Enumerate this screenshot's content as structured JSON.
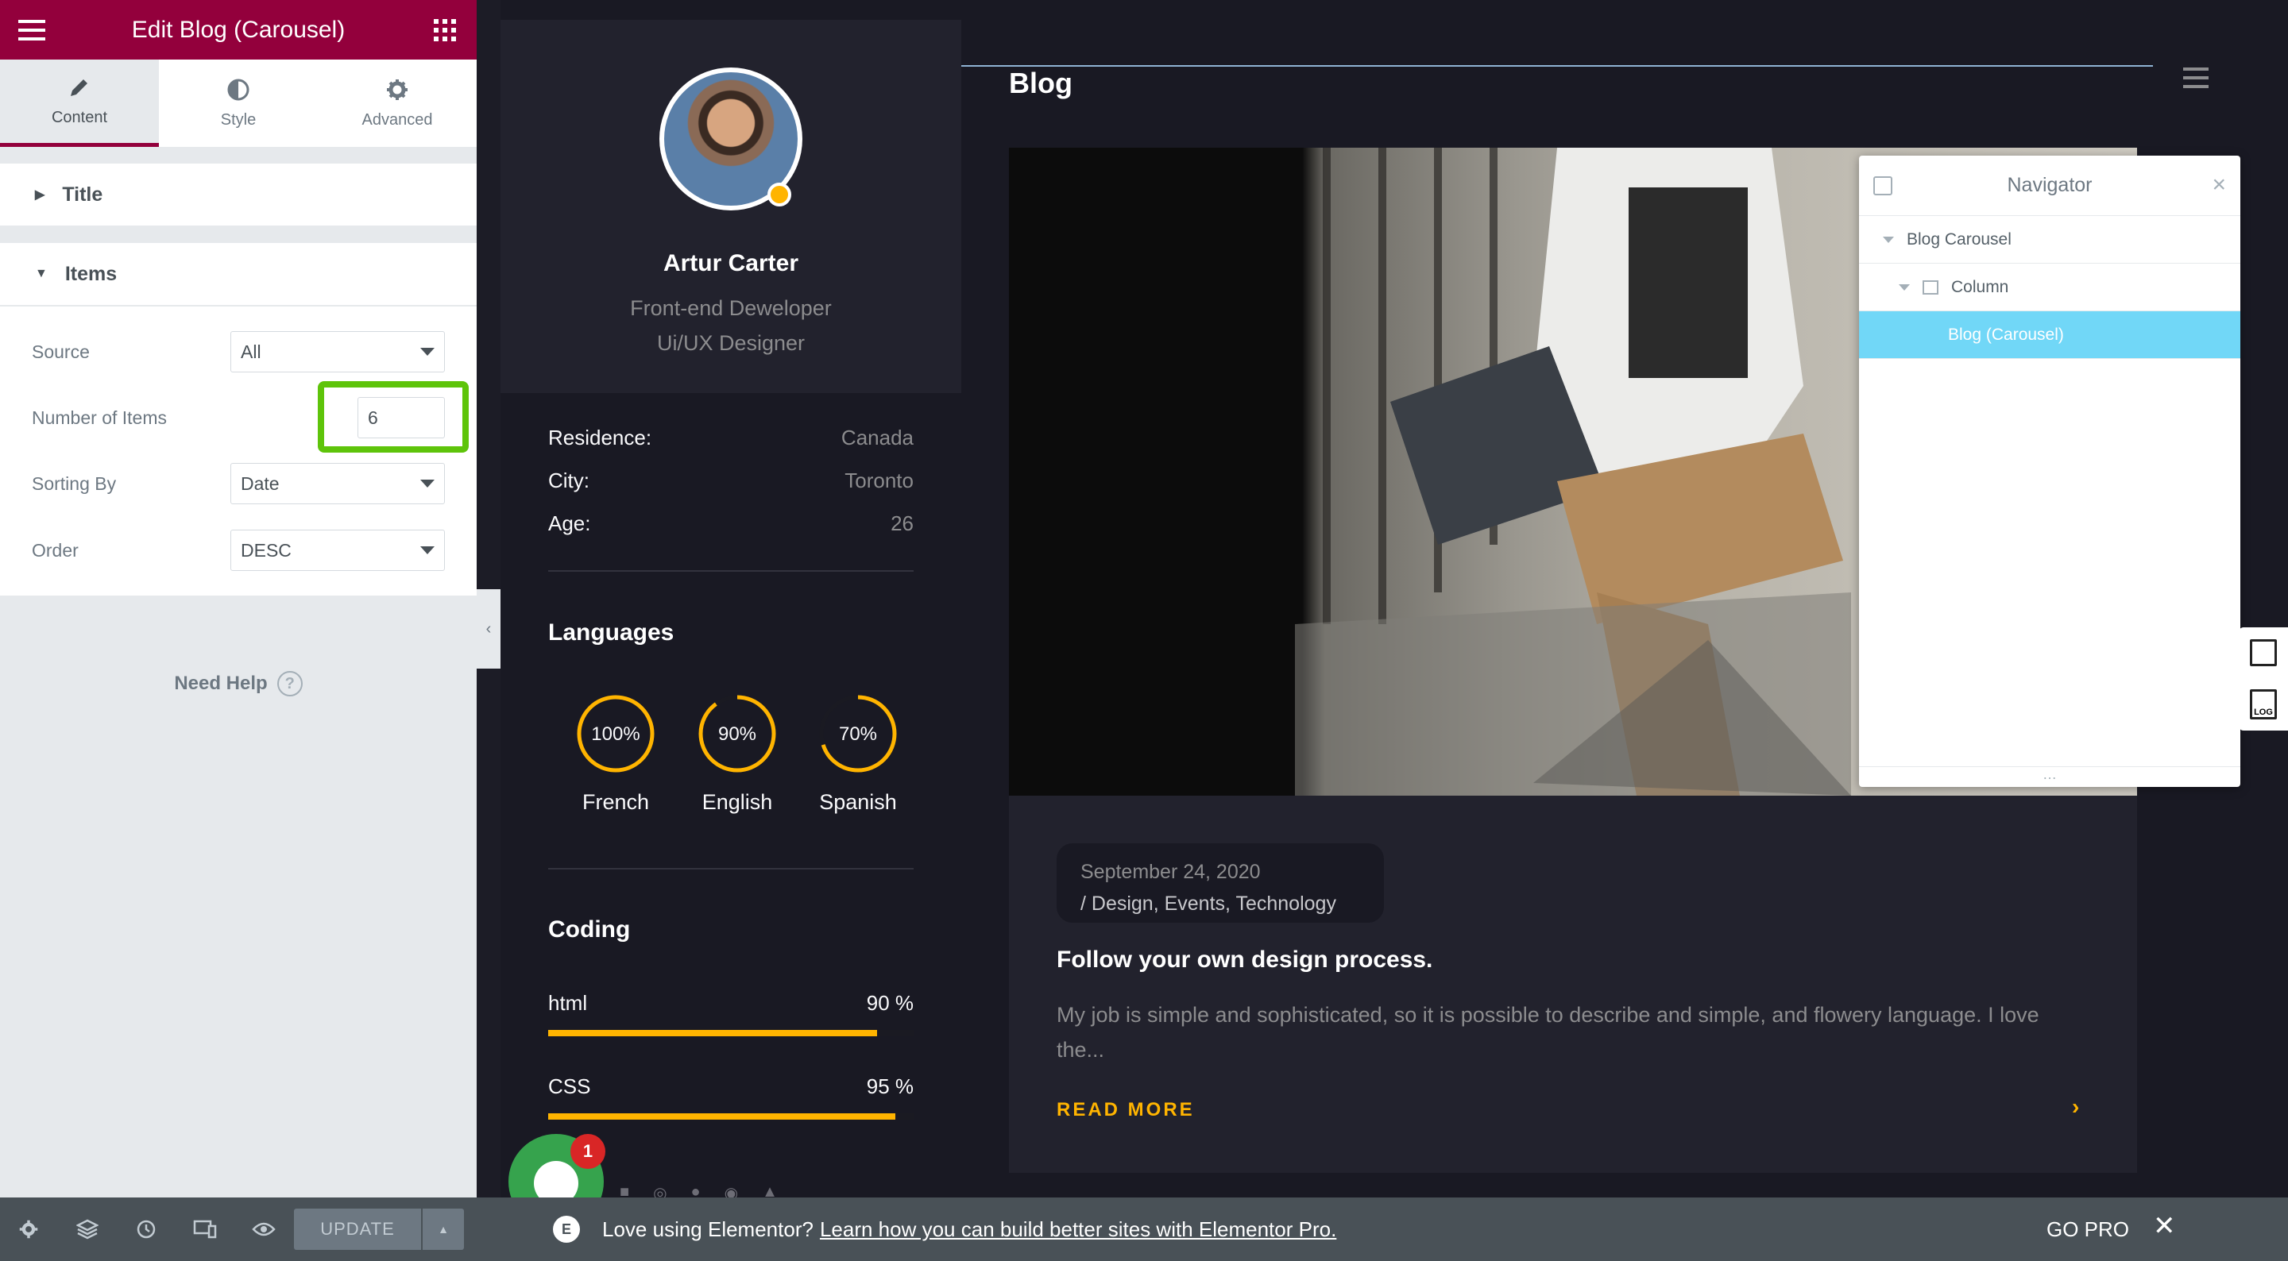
{
  "panel": {
    "header_title": "Edit Blog (Carousel)",
    "tabs": [
      {
        "label": "Content",
        "icon": "pencil-icon"
      },
      {
        "label": "Style",
        "icon": "contrast-icon"
      },
      {
        "label": "Advanced",
        "icon": "gear-icon"
      }
    ],
    "sections": {
      "title": "Title",
      "items": "Items"
    },
    "controls": {
      "source_label": "Source",
      "source_value": "All",
      "number_label": "Number of Items",
      "number_value": "6",
      "sorting_label": "Sorting By",
      "sorting_value": "Date",
      "order_label": "Order",
      "order_value": "DESC"
    },
    "need_help": "Need Help",
    "footer": {
      "update_label": "UPDATE"
    }
  },
  "profile": {
    "name": "Artur Carter",
    "role_line1": "Front-end Deweloper",
    "role_line2": "Ui/UX Designer",
    "info": [
      {
        "k": "Residence:",
        "v": "Canada"
      },
      {
        "k": "City:",
        "v": "Toronto"
      },
      {
        "k": "Age:",
        "v": "26"
      }
    ],
    "languages_title": "Languages",
    "languages": [
      {
        "name": "French",
        "pct_label": "100%",
        "pct": 100
      },
      {
        "name": "English",
        "pct_label": "90%",
        "pct": 90
      },
      {
        "name": "Spanish",
        "pct_label": "70%",
        "pct": 70
      }
    ],
    "coding_title": "Coding",
    "skills": [
      {
        "name": "html",
        "pct_label": "90 %",
        "pct": 90
      },
      {
        "name": "CSS",
        "pct_label": "95 %",
        "pct": 95
      }
    ]
  },
  "blog": {
    "title": "Blog",
    "date": "September 24, 2020",
    "categories": "/ Design, Events, Technology",
    "post_title": "Follow your own design process.",
    "excerpt": "My job is simple and sophisticated, so it is possible to describe and simple, and flowery language. I love the...",
    "read_more": "READ MORE"
  },
  "navigator": {
    "title": "Navigator",
    "items": [
      {
        "label": "Blog Carousel"
      },
      {
        "label": "Column"
      },
      {
        "label": "Blog (Carousel)"
      }
    ]
  },
  "chat": {
    "badge": "1"
  },
  "promo": {
    "lead": "Love using Elementor?",
    "link": "Learn how you can build better sites with Elementor Pro.",
    "go_pro": "GO PRO"
  },
  "colors": {
    "panel_accent": "#93003c",
    "highlight": "#5ec40a",
    "theme_accent": "#ffb400",
    "navigator_selected": "#71d7f7"
  }
}
